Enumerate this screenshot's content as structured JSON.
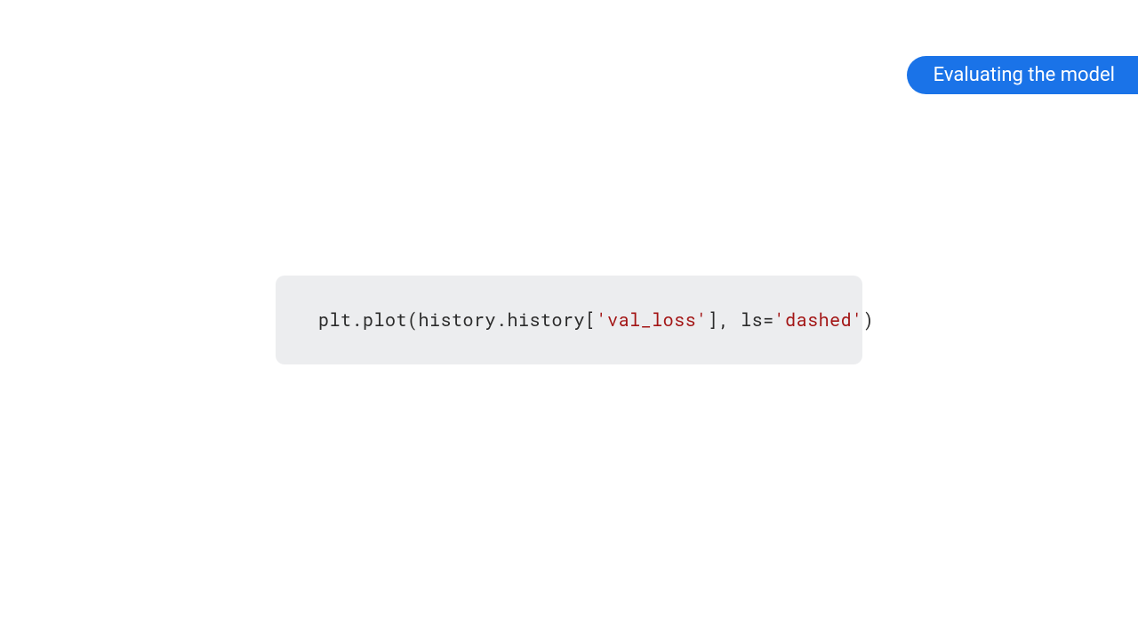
{
  "badge": {
    "label": "Evaluating the model"
  },
  "code": {
    "seg1": "plt.plot(history.history[",
    "str1": "'val_loss'",
    "seg2": "], ls=",
    "str2": "'dashed'",
    "seg3": ")"
  }
}
